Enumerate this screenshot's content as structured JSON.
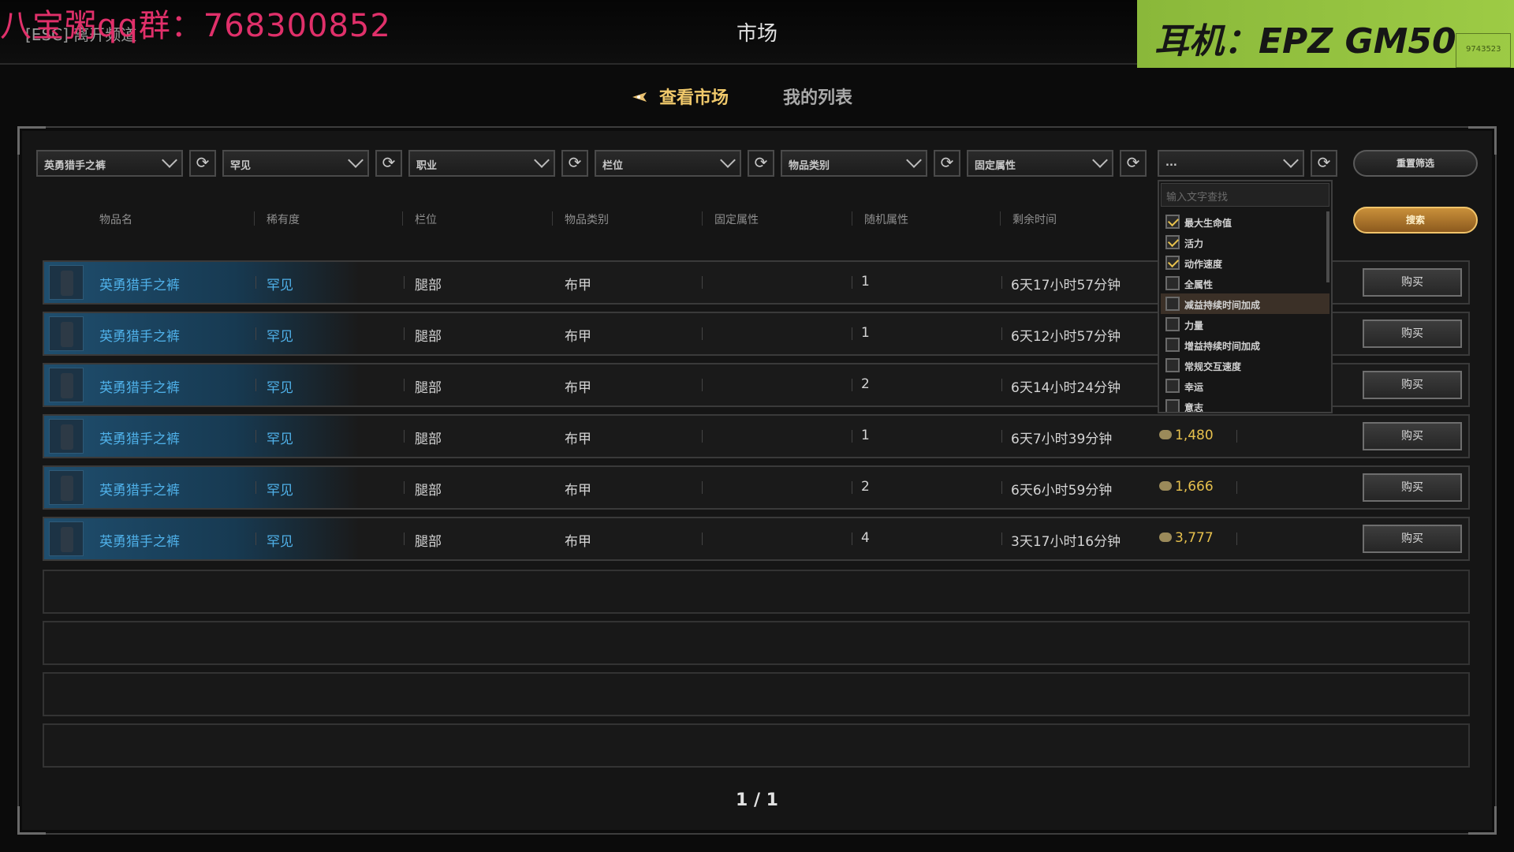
{
  "overlay": {
    "ad_text": "八宝粥qq群：768300852",
    "esc_hint": "[ESC] 离开频道",
    "headphone_ad": "耳机：EPZ GM50",
    "headphone_sub": "9743523"
  },
  "window": {
    "title": "市场"
  },
  "tabs": {
    "active": "查看市场",
    "mine": "我的列表"
  },
  "filters": [
    {
      "label": "英勇猎手之裤"
    },
    {
      "label": "罕见"
    },
    {
      "label": "职业"
    },
    {
      "label": "栏位"
    },
    {
      "label": "物品类别"
    },
    {
      "label": "固定属性"
    },
    {
      "label": "..."
    }
  ],
  "buttons": {
    "reset": "重置筛选",
    "search": "搜索",
    "buy": "购买"
  },
  "columns": [
    "物品名",
    "稀有度",
    "栏位",
    "物品类别",
    "固定属性",
    "随机属性",
    "剩余时间"
  ],
  "rows": [
    {
      "name": "英勇猎手之裤",
      "rarity": "罕见",
      "slot": "腿部",
      "type": "布甲",
      "fixed": "",
      "random": "1",
      "time": "6天17小时57分钟",
      "price": ""
    },
    {
      "name": "英勇猎手之裤",
      "rarity": "罕见",
      "slot": "腿部",
      "type": "布甲",
      "fixed": "",
      "random": "1",
      "time": "6天12小时57分钟",
      "price": ""
    },
    {
      "name": "英勇猎手之裤",
      "rarity": "罕见",
      "slot": "腿部",
      "type": "布甲",
      "fixed": "",
      "random": "2",
      "time": "6天14小时24分钟",
      "price": ""
    },
    {
      "name": "英勇猎手之裤",
      "rarity": "罕见",
      "slot": "腿部",
      "type": "布甲",
      "fixed": "",
      "random": "1",
      "time": "6天7小时39分钟",
      "price": "1,480"
    },
    {
      "name": "英勇猎手之裤",
      "rarity": "罕见",
      "slot": "腿部",
      "type": "布甲",
      "fixed": "",
      "random": "2",
      "time": "6天6小时59分钟",
      "price": "1,666"
    },
    {
      "name": "英勇猎手之裤",
      "rarity": "罕见",
      "slot": "腿部",
      "type": "布甲",
      "fixed": "",
      "random": "4",
      "time": "3天17小时16分钟",
      "price": "3,777"
    }
  ],
  "dropdown": {
    "placeholder": "输入文字查找",
    "items": [
      {
        "label": "最大生命值",
        "checked": true
      },
      {
        "label": "活力",
        "checked": true
      },
      {
        "label": "动作速度",
        "checked": true
      },
      {
        "label": "全属性",
        "checked": false
      },
      {
        "label": "减益持续时间加成",
        "checked": false,
        "highlighted": true
      },
      {
        "label": "力量",
        "checked": false
      },
      {
        "label": "增益持续时间加成",
        "checked": false
      },
      {
        "label": "常规交互速度",
        "checked": false
      },
      {
        "label": "幸运",
        "checked": false
      },
      {
        "label": "意志",
        "checked": false
      }
    ]
  },
  "pager": {
    "text": "1 / 1"
  },
  "colors": {
    "accent_gold": "#f0c96b",
    "rarity_blue": "#4fb0e8",
    "ad_pink": "#e0306a",
    "ad_green": "#9dcb45"
  }
}
